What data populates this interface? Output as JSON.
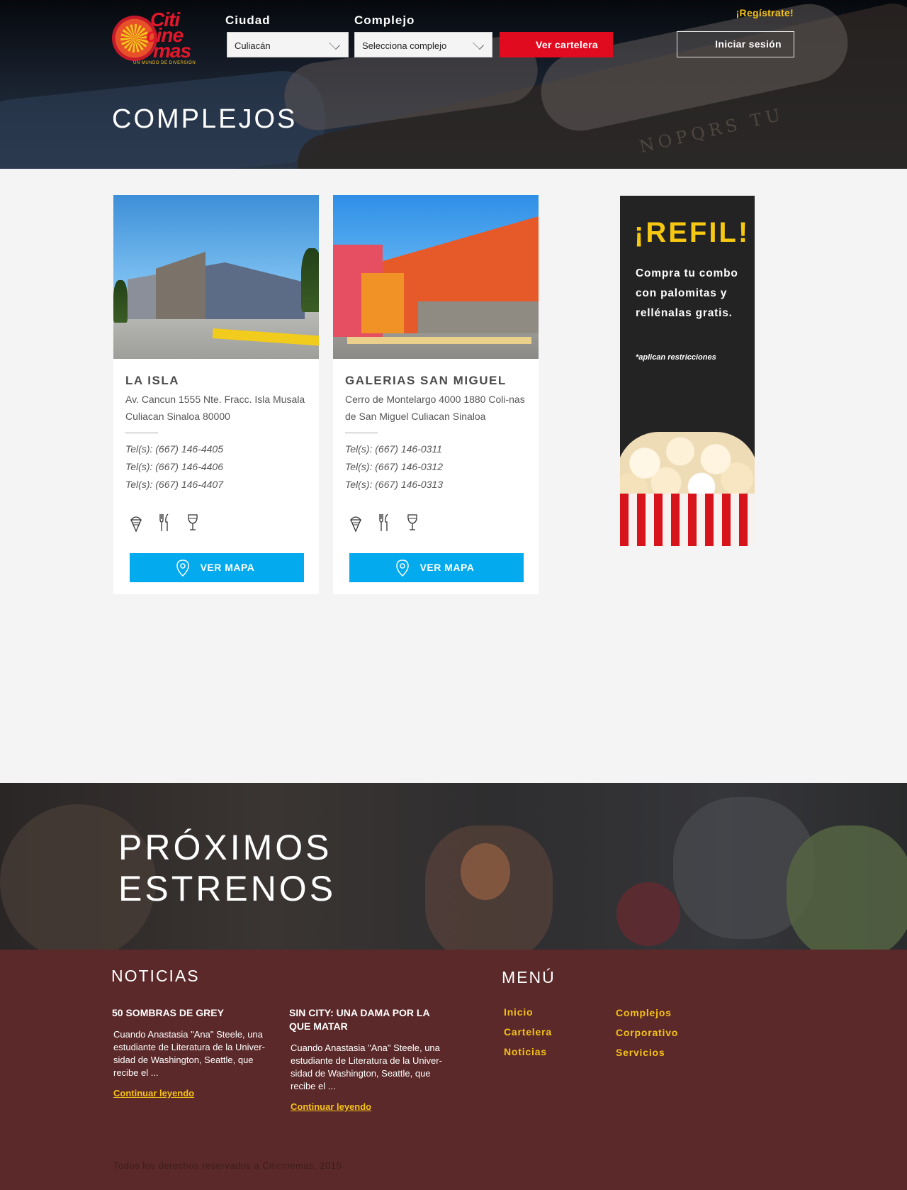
{
  "header": {
    "logo_words": [
      "Citi",
      "cine",
      "mas"
    ],
    "logo_tagline": "UN MUNDO DE DIVERSIÓN",
    "city_label": "Ciudad",
    "city_value": "Culiacán",
    "complex_label": "Complejo",
    "complex_value": "Selecciona complejo",
    "cartelera_button": "Ver cartelera",
    "register_link": "¡Regístrate!",
    "login_button": "Iniciar sesión",
    "page_title": "COMPLEJOS"
  },
  "complexes": [
    {
      "name": "LA ISLA",
      "address": "Av. Cancun 1555 Nte. Fracc. Isla Musala Culiacan Sinaloa 80000",
      "phones": [
        "Tel(s): (667) 146-4405",
        "Tel(s): (667) 146-4406",
        "Tel(s): (667) 146-4407"
      ],
      "amenities": [
        "ice-cream-icon",
        "cutlery-icon",
        "wine-glass-icon"
      ],
      "map_button": "VER MAPA"
    },
    {
      "name": "GALERIAS SAN MIGUEL",
      "address": "Cerro de Montelargo 4000 1880 Coli-nas de San Miguel Culiacan Sinaloa",
      "phones": [
        "Tel(s): (667) 146-0311",
        "Tel(s): (667) 146-0312",
        "Tel(s): (667) 146-0313"
      ],
      "amenities": [
        "ice-cream-icon",
        "cutlery-icon",
        "wine-glass-icon"
      ],
      "map_button": "VER MAPA"
    }
  ],
  "ad": {
    "headline": "¡REFIL!",
    "text": "Compra tu combo con palomitas y rellénalas gratis.",
    "restriction": "*aplican restricciones"
  },
  "upcoming": {
    "title_line1": "PRÓXIMOS",
    "title_line2": "ESTRENOS"
  },
  "footer": {
    "news_heading": "NOTICIAS",
    "news": [
      {
        "title": "50 SOMBRAS DE GREY",
        "body": "Cuando Anastasia \"Ana\" Steele, una estudiante de Literatura de la Univer-sidad de Washington, Seattle, que recibe el ...",
        "link": "Continuar leyendo"
      },
      {
        "title": "SIN CITY: UNA DAMA POR LA QUE MATAR",
        "body": "Cuando Anastasia \"Ana\" Steele, una estudiante de Literatura de la Univer-sidad de Washington, Seattle, que recibe el ...",
        "link": "Continuar leyendo"
      }
    ],
    "menu_heading": "MENÚ",
    "menu_col1": [
      "Inicio",
      "Cartelera",
      "Noticias"
    ],
    "menu_col2": [
      "Complejos",
      "Corporativo",
      "Servicios"
    ],
    "copyright": "Todos los derechos reservados a Citicinemas, 2015"
  },
  "colors": {
    "brand_red": "#e10b1f",
    "accent_yellow": "#f5c218",
    "map_blue": "#03aaee",
    "footer_bg": "#5b292a"
  }
}
